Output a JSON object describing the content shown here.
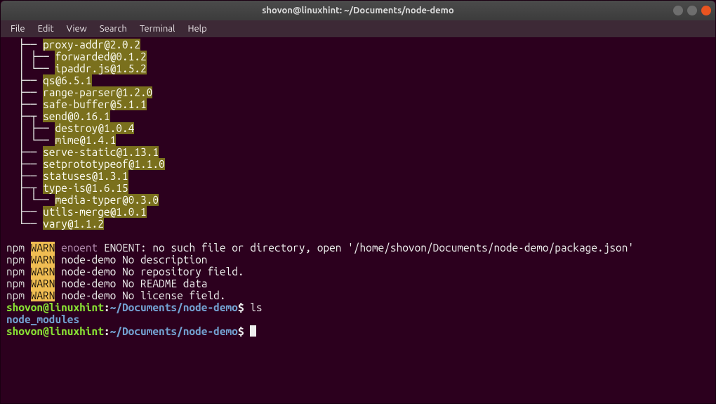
{
  "titlebar": {
    "title": "shovon@linuxhint: ~/Documents/node-demo"
  },
  "menubar": {
    "items": [
      "File",
      "Edit",
      "View",
      "Search",
      "Terminal",
      "Help"
    ]
  },
  "tree": [
    {
      "prefix": "  ├── ",
      "pkg": "proxy-addr@2.0.2"
    },
    {
      "prefix": "  │ ├── ",
      "pkg": "forwarded@0.1.2"
    },
    {
      "prefix": "  │ └── ",
      "pkg": "ipaddr.js@1.5.2"
    },
    {
      "prefix": "  ├── ",
      "pkg": "qs@6.5.1"
    },
    {
      "prefix": "  ├── ",
      "pkg": "range-parser@1.2.0"
    },
    {
      "prefix": "  ├── ",
      "pkg": "safe-buffer@5.1.1"
    },
    {
      "prefix": "  ├─┬ ",
      "pkg": "send@0.16.1"
    },
    {
      "prefix": "  │ ├── ",
      "pkg": "destroy@1.0.4"
    },
    {
      "prefix": "  │ └── ",
      "pkg": "mime@1.4.1"
    },
    {
      "prefix": "  ├── ",
      "pkg": "serve-static@1.13.1"
    },
    {
      "prefix": "  ├── ",
      "pkg": "setprototypeof@1.1.0"
    },
    {
      "prefix": "  ├── ",
      "pkg": "statuses@1.3.1"
    },
    {
      "prefix": "  ├─┬ ",
      "pkg": "type-is@1.6.15"
    },
    {
      "prefix": "  │ └── ",
      "pkg": "media-typer@0.3.0"
    },
    {
      "prefix": "  ├── ",
      "pkg": "utils-merge@1.0.1"
    },
    {
      "prefix": "  └── ",
      "pkg": "vary@1.1.2"
    }
  ],
  "warnings": [
    {
      "npm": "npm",
      "warn": "WARN",
      "tag": "enoent",
      "msg": " ENOENT: no such file or directory, open '/home/shovon/Documents/node-demo/package.json'"
    },
    {
      "npm": "npm",
      "warn": "WARN",
      "tag": "",
      "msg": " node-demo No description"
    },
    {
      "npm": "npm",
      "warn": "WARN",
      "tag": "",
      "msg": " node-demo No repository field."
    },
    {
      "npm": "npm",
      "warn": "WARN",
      "tag": "",
      "msg": " node-demo No README data"
    },
    {
      "npm": "npm",
      "warn": "WARN",
      "tag": "",
      "msg": " node-demo No license field."
    }
  ],
  "prompt1": {
    "user": "shovon@linuxhint",
    "sep": ":",
    "path": "~/Documents/node-demo",
    "dollar": "$",
    "cmd": " ls"
  },
  "ls_output": "node_modules",
  "prompt2": {
    "user": "shovon@linuxhint",
    "sep": ":",
    "path": "~/Documents/node-demo",
    "dollar": "$",
    "cmd": " "
  }
}
